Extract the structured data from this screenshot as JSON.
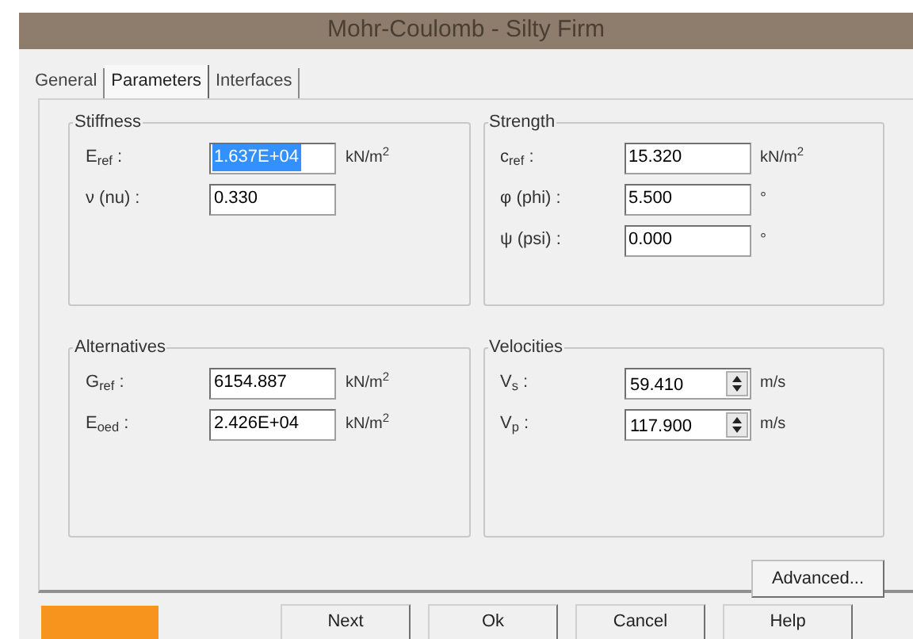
{
  "window": {
    "title": "Mohr-Coulomb - Silty Firm"
  },
  "tabs": [
    {
      "label": "General",
      "selected": false
    },
    {
      "label": "Parameters",
      "selected": true
    },
    {
      "label": "Interfaces",
      "selected": false
    }
  ],
  "groups": [
    {
      "title": "Stiffness",
      "rows": [
        {
          "label": "E$_{ref}$ :",
          "kind": "text",
          "value": "1.637E+04",
          "selected": true,
          "unit": "kN/m$^{2}$"
        },
        {
          "label": "ν (nu) :",
          "kind": "text",
          "value": "0.330",
          "selected": false
        }
      ]
    },
    {
      "title": "Strength",
      "rows": [
        {
          "label": "c$_{ref}$ :",
          "kind": "text",
          "value": "15.320",
          "selected": false,
          "unit": "kN/m$^{2}$"
        },
        {
          "label": "φ (phi) :",
          "kind": "text",
          "value": "5.500",
          "selected": false,
          "unit": "°"
        },
        {
          "label": "ψ (psi) :",
          "kind": "text",
          "value": "0.000",
          "selected": false,
          "unit": "°"
        }
      ]
    },
    {
      "title": "Alternatives",
      "rows": [
        {
          "label": "G$_{ref}$ :",
          "kind": "text",
          "value": "6154.887",
          "selected": false,
          "unit": "kN/m$^{2}$"
        },
        {
          "label": "E$_{oed}$ :",
          "kind": "text",
          "value": "2.426E+04",
          "selected": false,
          "unit": "kN/m$^{2}$"
        }
      ]
    },
    {
      "title": "Velocities",
      "rows": [
        {
          "label": "V$_{s}$ :",
          "kind": "spin",
          "value": "59.410",
          "selected": false,
          "unit": "m/s"
        },
        {
          "label": "V$_{p}$ :",
          "kind": "spin",
          "value": "117.900",
          "selected": false,
          "unit": "m/s"
        }
      ]
    }
  ],
  "advanced_button": "Advanced...",
  "buttons": [
    "Next",
    "Ok",
    "Cancel",
    "Help"
  ]
}
